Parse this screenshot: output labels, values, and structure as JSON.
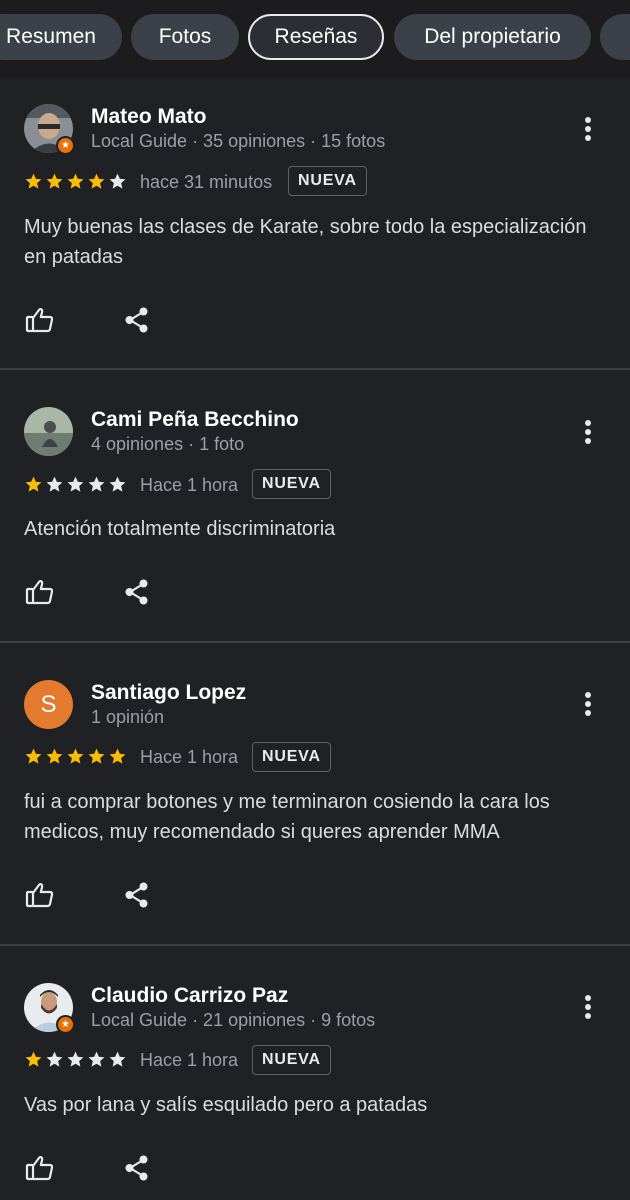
{
  "tabs": [
    {
      "label": "Resumen",
      "active": false
    },
    {
      "label": "Fotos",
      "active": false
    },
    {
      "label": "Reseñas",
      "active": true
    },
    {
      "label": "Del propietario",
      "active": false
    }
  ],
  "colors": {
    "background": "#202124",
    "star_filled": "#fbbc04",
    "star_empty": "#e8eaed",
    "guide_badge": "#e8710a",
    "letter_avatar": "#e37a2e"
  },
  "icons": {
    "like": "thumb-up-outline-icon",
    "share": "share-icon",
    "more": "more-vertical-icon",
    "local_guide": "local-guide-star-icon"
  },
  "reviews": [
    {
      "author": "Mateo Mato",
      "meta": "Local Guide · 35 opiniones · 15 fotos",
      "rating": 4,
      "time": "hace 31 minutos",
      "badge": "NUEVA",
      "text": "Muy buenas las clases de Karate, sobre todo la especialización en patadas",
      "avatar_letter": "",
      "local_guide": true
    },
    {
      "author": "Cami Peña Becchino",
      "meta": "4 opiniones · 1 foto",
      "rating": 1,
      "time": "Hace 1 hora",
      "badge": "NUEVA",
      "text": "Atención totalmente discriminatoria",
      "avatar_letter": "",
      "local_guide": false
    },
    {
      "author": "Santiago Lopez",
      "meta": "1 opinión",
      "rating": 5,
      "time": "Hace 1 hora",
      "badge": "NUEVA",
      "text": "fui a comprar botones y me terminaron cosiendo la cara los medicos, muy recomendado si queres aprender MMA",
      "avatar_letter": "S",
      "local_guide": false
    },
    {
      "author": "Claudio Carrizo Paz",
      "meta": "Local Guide · 21 opiniones · 9 fotos",
      "rating": 1,
      "time": "Hace 1 hora",
      "badge": "NUEVA",
      "text": "Vas por lana y salís esquilado pero a patadas",
      "avatar_letter": "",
      "local_guide": true
    }
  ]
}
